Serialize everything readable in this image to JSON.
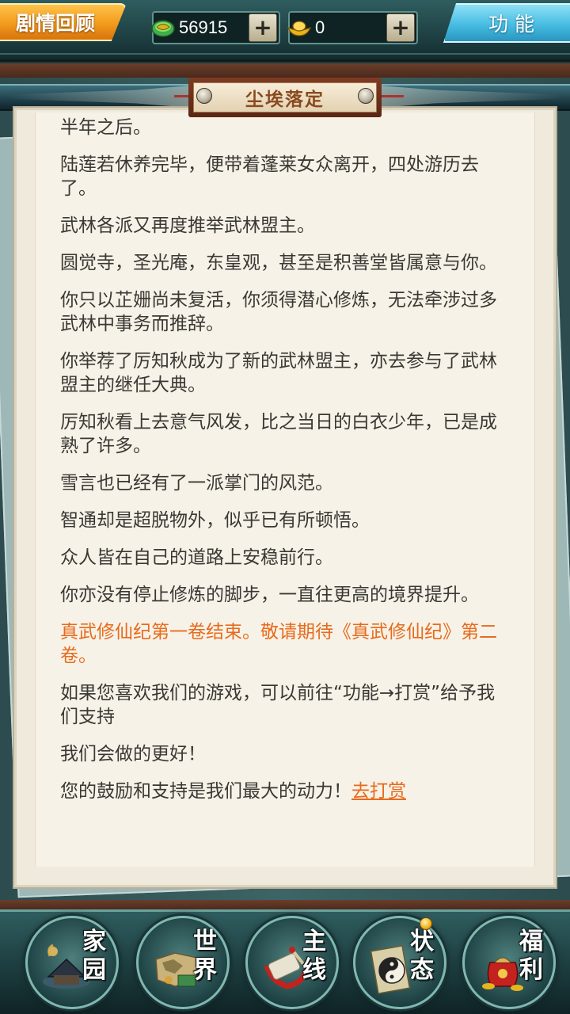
{
  "top_bar": {
    "story_review_label": "剧情回顾",
    "gold_value": "56915",
    "ingot_value": "0",
    "plus_label": "+",
    "function_label": "功能"
  },
  "chapter": {
    "title": "尘埃落定"
  },
  "story": {
    "paragraphs": [
      "半年之后。",
      "陆莲若休养完毕，便带着蓬莱女众离开，四处游历去了。",
      "武林各派又再度推举武林盟主。",
      "圆觉寺，圣光庵，东皇观，甚至是积善堂皆属意与你。",
      "你只以芷姗尚未复活，你须得潜心修炼，无法牵涉过多武林中事务而推辞。",
      "你举荐了厉知秋成为了新的武林盟主，亦去参与了武林盟主的继任大典。",
      "厉知秋看上去意气风发，比之当日的白衣少年，已是成熟了许多。",
      "雪言也已经有了一派掌门的风范。",
      "智通却是超脱物外，似乎已有所顿悟。",
      "众人皆在自己的道路上安稳前行。",
      "你亦没有停止修炼的脚步，一直往更高的境界提升。",
      "真武修仙纪第一卷结束。敬请期待《真武修仙纪》第二卷。",
      "如果您喜欢我们的游戏，可以前往“功能→打赏”给予我们支持",
      "我们会做的更好！",
      "您的鼓励和支持是我们最大的动力！"
    ],
    "reward_link": "去打赏"
  },
  "bottom_nav": {
    "items": [
      {
        "label": "家园",
        "icon": "home-icon"
      },
      {
        "label": "世界",
        "icon": "world-map-icon"
      },
      {
        "label": "主线",
        "icon": "main-quest-icon"
      },
      {
        "label": "状态",
        "icon": "bagua-icon"
      },
      {
        "label": "福利",
        "icon": "treasure-bag-icon"
      }
    ]
  },
  "colors": {
    "accent_orange": "#e86a1c",
    "story_text": "#3b3834",
    "paper": "#f6f2e7"
  }
}
